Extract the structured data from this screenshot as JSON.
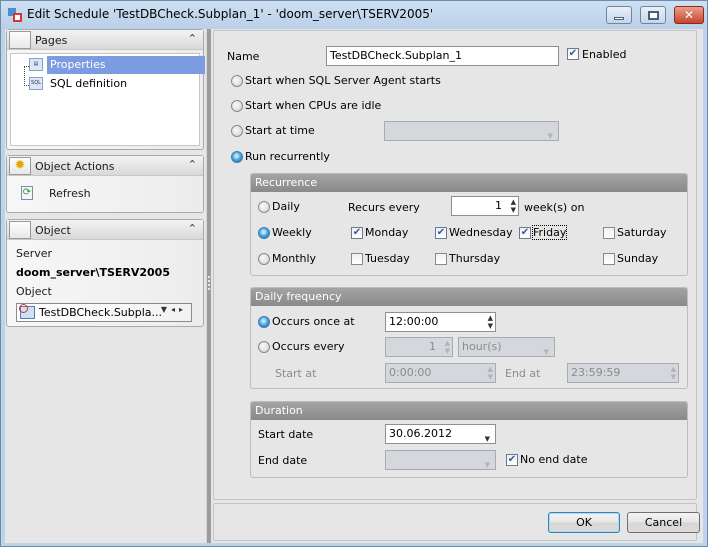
{
  "window": {
    "title": "Edit Schedule 'TestDBCheck.Subplan_1' - 'doom_server\\TSERV2005'",
    "controls": [
      "minimize",
      "maximize",
      "close"
    ]
  },
  "sidebar": {
    "pages": {
      "title": "Pages",
      "items": [
        {
          "label": "Properties",
          "icon": "properties-icon",
          "selected": true
        },
        {
          "label": "SQL definition",
          "icon": "sql-icon",
          "selected": false
        }
      ]
    },
    "actions": {
      "title": "Object Actions",
      "items": [
        {
          "label": "Refresh",
          "icon": "refresh-icon"
        }
      ]
    },
    "object": {
      "title": "Object",
      "server_label": "Server",
      "server_value": "doom_server\\TSERV2005",
      "object_label": "Object",
      "object_value": "TestDBCheck.Subpla..."
    }
  },
  "form": {
    "name_label": "Name",
    "name_value": "TestDBCheck.Subplan_1",
    "enabled_label": "Enabled",
    "enabled": true,
    "start_options": [
      {
        "label": "Start when SQL Server Agent starts",
        "selected": false
      },
      {
        "label": "Start when CPUs are idle",
        "selected": false
      },
      {
        "label": "Start at time",
        "selected": false
      },
      {
        "label": "Run recurrently",
        "selected": true
      }
    ],
    "start_at_time_value": "",
    "recurrence": {
      "title": "Recurrence",
      "types": [
        {
          "label": "Daily",
          "selected": false
        },
        {
          "label": "Weekly",
          "selected": true
        },
        {
          "label": "Monthly",
          "selected": false
        }
      ],
      "recurs_every_label": "Recurs every",
      "recurs_every_value": "1",
      "recurs_every_unit": "week(s) on",
      "days": [
        {
          "label": "Monday",
          "checked": true
        },
        {
          "label": "Wednesday",
          "checked": true
        },
        {
          "label": "Friday",
          "checked": true
        },
        {
          "label": "Saturday",
          "checked": false
        },
        {
          "label": "Tuesday",
          "checked": false
        },
        {
          "label": "Thursday",
          "checked": false
        },
        {
          "label": "Sunday",
          "checked": false
        }
      ]
    },
    "daily_frequency": {
      "title": "Daily frequency",
      "once_label": "Occurs once at",
      "once_selected": true,
      "once_value": "12:00:00",
      "every_label": "Occurs every",
      "every_selected": false,
      "every_value": "1",
      "every_unit": "hour(s)",
      "start_label": "Start at",
      "start_value": "0:00:00",
      "end_label": "End at",
      "end_value": "23:59:59"
    },
    "duration": {
      "title": "Duration",
      "start_label": "Start date",
      "start_value": "30.06.2012",
      "end_label": "End date",
      "end_value": "",
      "no_end_label": "No end date",
      "no_end_checked": true
    }
  },
  "buttons": {
    "ok": "OK",
    "cancel": "Cancel"
  },
  "icons": {
    "check": "✔",
    "chevron_up": "⌃",
    "dropdown": "▼",
    "spin_up": "▲",
    "spin_down": "▼"
  }
}
